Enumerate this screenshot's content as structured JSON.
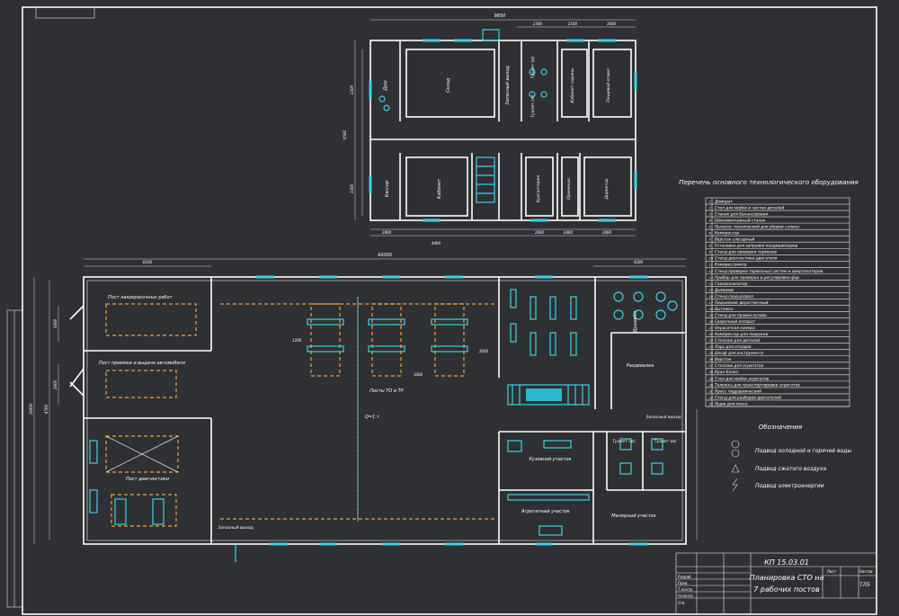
{
  "colors": {
    "background": "#2e3033",
    "lines": "#ffffff",
    "equipment": "#3fd0e6",
    "posts": "#f0a040"
  },
  "upper_plan": {
    "overall_dim": "9850",
    "rooms": [
      "Душ",
      "Склад",
      "Запасный выход",
      "Туалет (м)",
      "Туалет (ж)",
      "Кабинет охраны",
      "Пищевой отдел",
      "Кассир",
      "Кабинет",
      "Бухгалтерия",
      "Приемная",
      "Директор"
    ],
    "dims_top": [
      "2300",
      "2100",
      "3000"
    ],
    "dims_left": [
      "3300",
      "6500",
      "3300"
    ],
    "dims_bottom": [
      "2800",
      "4400",
      "2800",
      "2400",
      "2400"
    ]
  },
  "lower_plan": {
    "overall_dim": "42000",
    "rooms": [
      "Пост лакокрасочных работ",
      "Пост приемки и выдачи автомобиля",
      "Пост диагностики",
      "Посты ТО и ТР",
      "Запасный выход",
      "Душевая",
      "Раздевалка",
      "Запасный выход",
      "Туалет (ж)",
      "Туалет (м)",
      "Кузовной участок",
      "Агрегатный участок",
      "Малярный участок"
    ],
    "misc_labels": [
      "Q=1 т",
      "1200",
      "2000",
      "1000"
    ],
    "dims_top": [
      "8100",
      "4200"
    ],
    "dims_left": [
      "2000",
      "2000",
      "4700",
      "18000"
    ]
  },
  "equipment_list": {
    "title": "Перечень основного технологического оборудования",
    "items": [
      "Домкрат",
      "Стол для мойки и чистки деталей",
      "Станок для балансировки",
      "Шиномонтажный станок",
      "Пылесос технический для уборки салона",
      "Компрессор",
      "Верстак слесарный",
      "Установка для заправки кондиционеров",
      "Стенд для проверки тормозов",
      "Стенд диагностики двигателя",
      "Компрессометр",
      "Стенд проверки тормозных систем и амортизаторов",
      "Прибор для проверки и регулировки фар",
      "Газоанализатор",
      "Дымомер",
      "Стенд сход-развал",
      "Подъемник двухстоечный",
      "Вытяжка",
      "Стенд для правки кузова",
      "Сварочный аппарат",
      "Окрасочная камера",
      "Компрессор для покраски",
      "Стеллаж для деталей",
      "Ларь для отходов",
      "Шкаф для инструмента",
      "Верстак",
      "Стеллаж для агрегатов",
      "Кран-балка",
      "Стол для мойки агрегатов",
      "Тележка для транспортировки агрегатов",
      "Пресс гидравлический",
      "Стенд для разборки двигателей",
      "Ящик для песка"
    ]
  },
  "legend": {
    "title": "Обозначения",
    "items": [
      "Подвод холодной и горячей воды",
      "Подвод сжатого воздуха",
      "Подвод электроэнергии"
    ]
  },
  "title_block": {
    "title_line1": "Планировка СТО на",
    "title_line2": "7 рабочих постов",
    "sheet_code": "ТЛ5",
    "code": "КП 15.03.01",
    "sheet_label": "Лист",
    "sheets_label": "Листов",
    "roles": [
      "Разраб.",
      "Пров.",
      "Т.контр.",
      "Н.контр.",
      "Утв."
    ]
  }
}
